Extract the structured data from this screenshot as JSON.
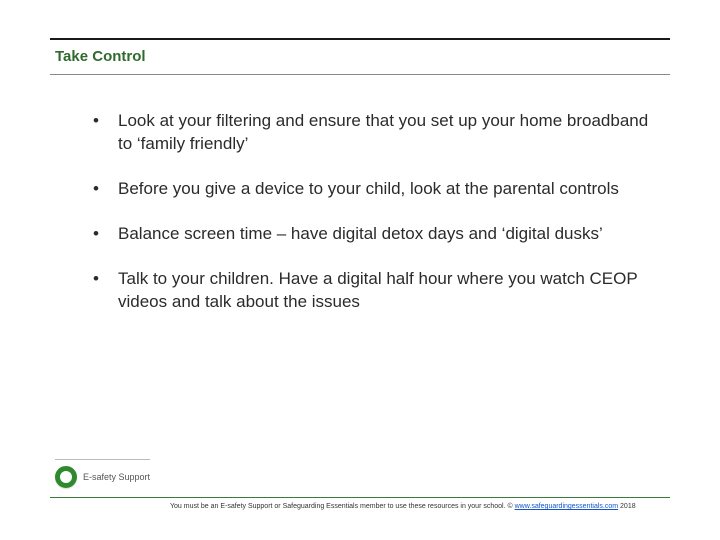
{
  "title": "Take Control",
  "bullets": [
    "Look at your filtering and ensure that you set up your home broadband to ‘family friendly’",
    "Before you give a device to your child, look at the parental controls",
    "Balance screen time – have digital detox days and ‘digital dusks’",
    "Talk to your children. Have a digital half hour where you watch CEOP videos and talk about the issues"
  ],
  "logo_text": "E-safety Support",
  "footer": {
    "prefix": "You must be an E-safety Support or Safeguarding Essentials member to use these resources in your school. © ",
    "link_text": "www.safeguardingessentials.com",
    "suffix": " 2018"
  }
}
